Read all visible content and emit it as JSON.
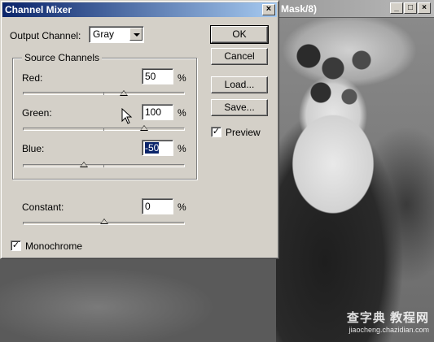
{
  "dialog": {
    "title": "Channel Mixer",
    "close_symbol": "×",
    "output_channel_label": "Output Channel:",
    "output_channel_value": "Gray",
    "source_group_title": "Source Channels",
    "channels": [
      {
        "label": "Red:",
        "value": "50",
        "unit": "%",
        "slider_value": 50
      },
      {
        "label": "Green:",
        "value": "100",
        "unit": "%",
        "slider_value": 100
      },
      {
        "label": "Blue:",
        "value": "-50",
        "unit": "%",
        "slider_value": -50
      }
    ],
    "constant": {
      "label": "Constant:",
      "value": "0",
      "unit": "%",
      "slider_value": 0
    },
    "monochrome_label": "Monochrome",
    "monochrome_checked": true,
    "preview_label": "Preview",
    "preview_checked": true,
    "buttons": {
      "ok": "OK",
      "cancel": "Cancel",
      "load": "Load...",
      "save": "Save..."
    }
  },
  "document": {
    "title": "Mask/8)",
    "window_buttons": [
      "_",
      "□",
      "×"
    ]
  },
  "watermark": {
    "line1": "查字典 教程网",
    "line2": "jiaocheng.chazidian.com"
  }
}
